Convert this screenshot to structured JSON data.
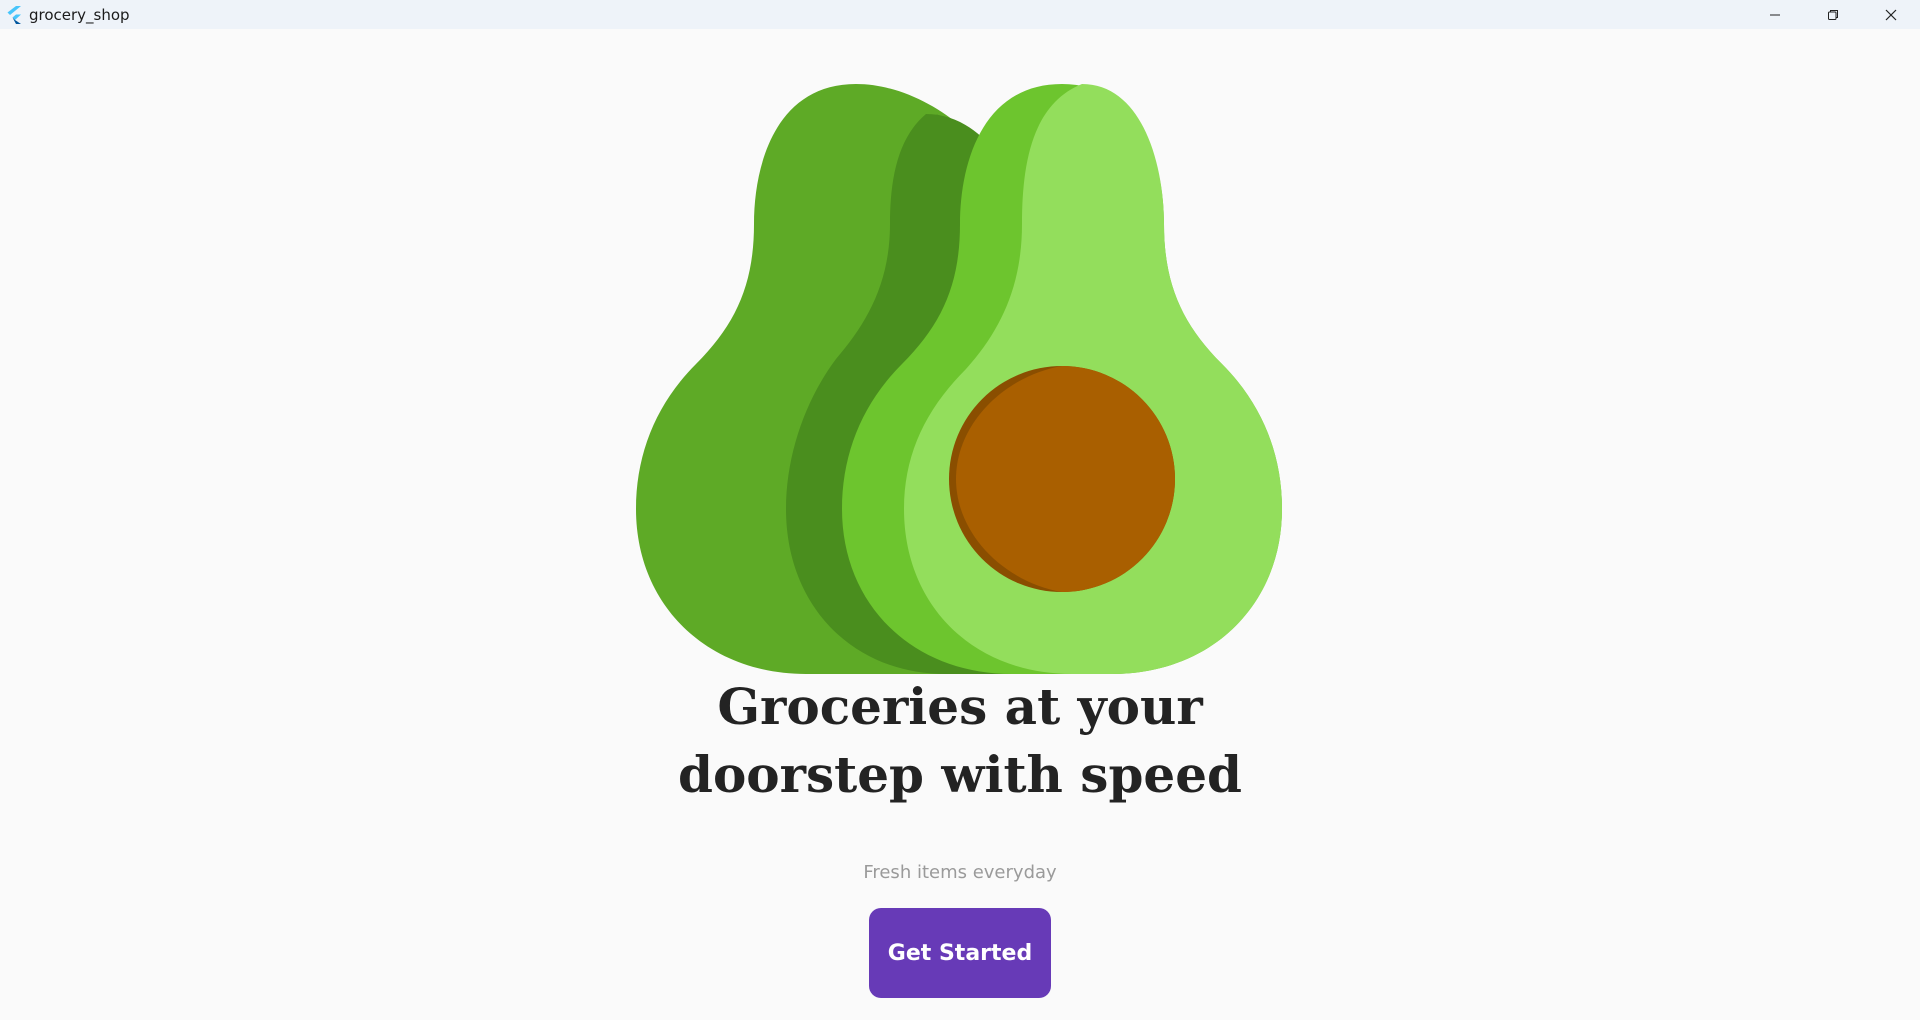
{
  "window": {
    "title": "grocery_shop",
    "app_icon": "flutter-logo-icon",
    "controls": [
      "minimize-icon",
      "restore-icon",
      "close-icon"
    ]
  },
  "hero": {
    "illustration": "avocado-icon",
    "colors": {
      "whole_skin": "#5eaa26",
      "whole_shadow": "#4a8e1e",
      "half_rim": "#6dc52e",
      "half_flesh": "#93de5c",
      "pit": "#a95f00",
      "pit_shadow": "#8a4e00"
    }
  },
  "onboarding": {
    "headline_line1": "Groceries at your",
    "headline_line2": "doorstep with speed",
    "subtitle": "Fresh items everyday",
    "cta_label": "Get Started"
  },
  "colors": {
    "accent": "#673ab7",
    "background": "#fafafa",
    "titlebar": "#eef3f9"
  }
}
